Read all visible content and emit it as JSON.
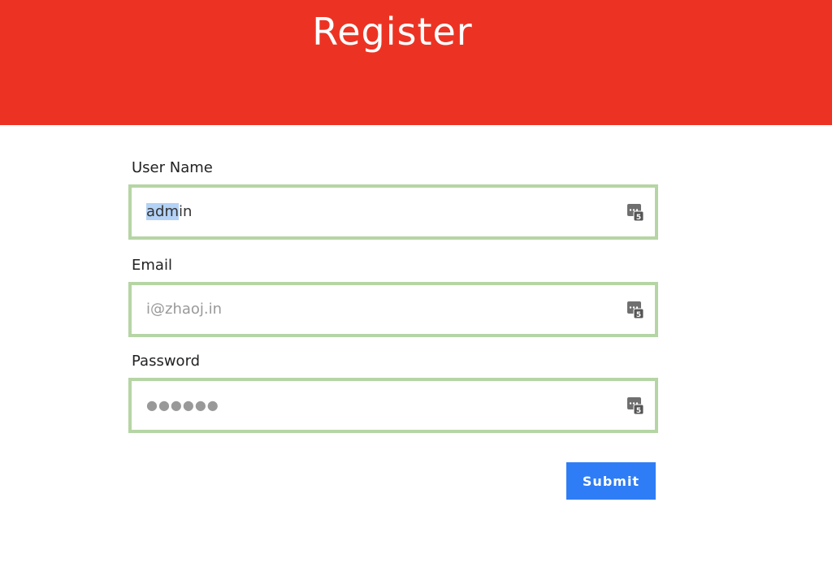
{
  "header": {
    "title": "Register",
    "background_color": "#ec3323"
  },
  "form": {
    "username": {
      "label": "User Name",
      "value_selected": "adm",
      "value_rest": "in",
      "icon": "password-manager-icon"
    },
    "email": {
      "label": "Email",
      "placeholder": "i@zhaoj.in",
      "icon": "password-manager-icon"
    },
    "password": {
      "label": "Password",
      "placeholder": "●●●●●●",
      "icon": "password-manager-icon"
    },
    "field_border_color": "#b6d5a5"
  },
  "submit": {
    "label": "Submit",
    "color": "#2f7df6"
  }
}
